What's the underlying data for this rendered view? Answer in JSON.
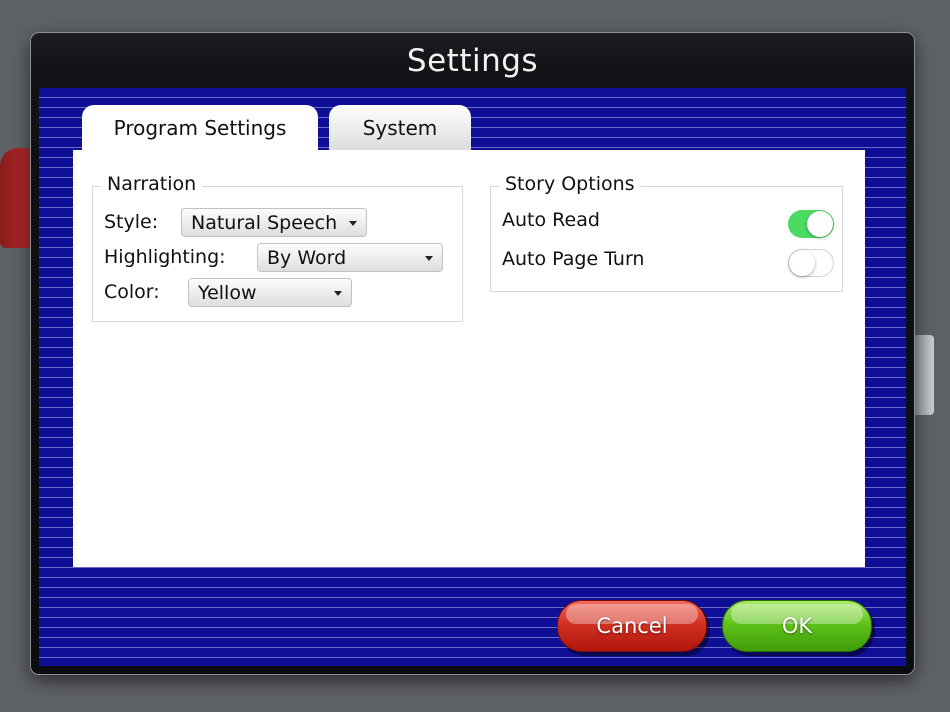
{
  "dialog": {
    "title": "Settings"
  },
  "tabs": [
    {
      "label": "Program Settings",
      "active": true
    },
    {
      "label": "System",
      "active": false
    }
  ],
  "narration": {
    "legend": "Narration",
    "style": {
      "label": "Style:",
      "value": "Natural Speech"
    },
    "highlighting": {
      "label": "Highlighting:",
      "value": "By Word"
    },
    "color": {
      "label": "Color:",
      "value": "Yellow"
    }
  },
  "story_options": {
    "legend": "Story Options",
    "auto_read": {
      "label": "Auto Read",
      "on": true
    },
    "auto_page_turn": {
      "label": "Auto Page Turn",
      "on": false
    }
  },
  "buttons": {
    "cancel": "Cancel",
    "ok": "OK"
  },
  "colors": {
    "stripe_blue": "#0e0e96",
    "toggle_on": "#4cd964",
    "cancel_red": "#d23124",
    "ok_green": "#5fc21b"
  }
}
